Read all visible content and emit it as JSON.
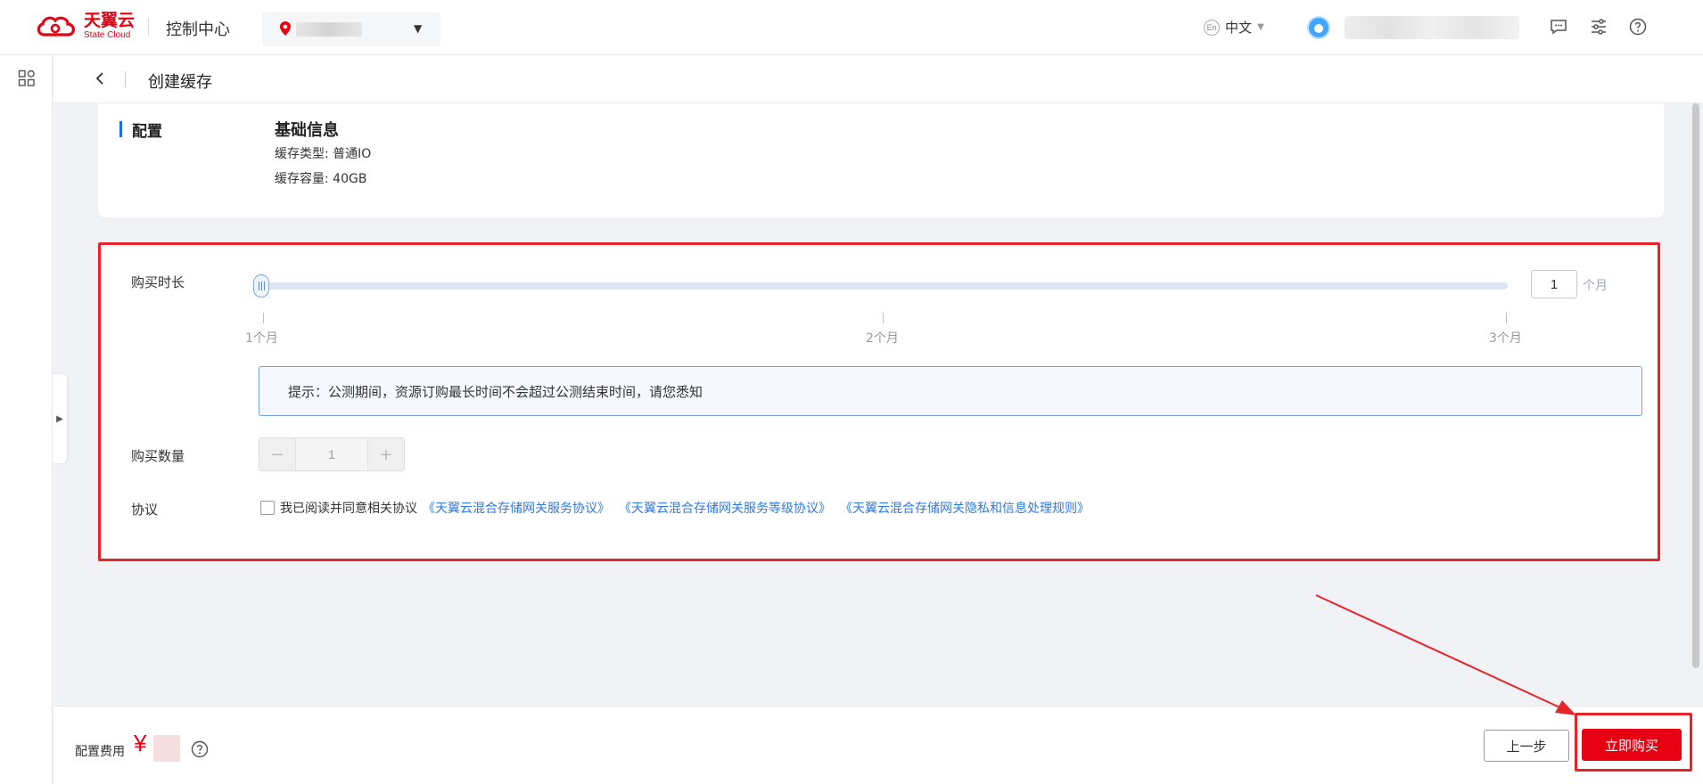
{
  "header": {
    "logo_cn": "天翼云",
    "logo_en": "State Cloud",
    "console_title": "控制中心",
    "language": "中文",
    "language_badge": "En"
  },
  "breadcrumb": {
    "title": "创建缓存"
  },
  "config": {
    "section_label": "配置",
    "basic_title": "基础信息",
    "cache_type": "缓存类型: 普通IO",
    "cache_capacity": "缓存容量: 40GB"
  },
  "purchase": {
    "duration_label": "购买时长",
    "duration_value": "1",
    "duration_unit": "个月",
    "slider_fraction": 0,
    "ticks": [
      "1个月",
      "2个月",
      "3个月"
    ],
    "notice": "提示：公测期间，资源订购最长时间不会超过公测结束时间，请您悉知",
    "quantity_label": "购买数量",
    "quantity_value": "1",
    "quantity_minus": "−",
    "quantity_plus": "+",
    "agreement_label": "协议",
    "agreement_text": "我已阅读并同意相关协议",
    "agreement_links": [
      "《天翼云混合存储网关服务协议》",
      "《天翼云混合存储网关服务等级协议》",
      "《天翼云混合存储网关隐私和信息处理规则》"
    ]
  },
  "footer": {
    "fee_label": "配置费用",
    "currency": "¥",
    "prev_button": "上一步",
    "buy_button": "立即购买"
  },
  "colors": {
    "brand_red": "#e60012",
    "highlight_red": "#e8242b",
    "link_blue": "#2e7ae0",
    "accent_blue": "#1f6ce0"
  },
  "icons": {
    "region": "location-pin-icon",
    "chat": "chat-icon",
    "settings": "sliders-icon",
    "help": "help-icon",
    "apps": "apps-grid-icon",
    "back": "chevron-left-icon"
  }
}
